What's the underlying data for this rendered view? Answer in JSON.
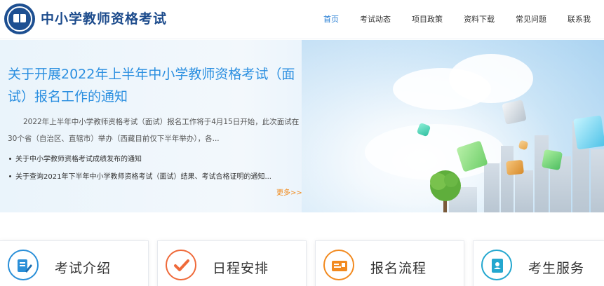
{
  "header": {
    "site_title": "中小学教师资格考试",
    "nav": [
      {
        "label": "首页",
        "active": true
      },
      {
        "label": "考试动态",
        "active": false
      },
      {
        "label": "项目政策",
        "active": false
      },
      {
        "label": "资料下载",
        "active": false
      },
      {
        "label": "常见问题",
        "active": false
      },
      {
        "label": "联系我",
        "active": false
      }
    ]
  },
  "banner": {
    "headline": "关于开展2022年上半年中小学教师资格考试（面试）报名工作的通知",
    "summary": "2022年上半年中小学教师资格考试（面试）报名工作将于4月15日开始，此次面试在30个省（自治区、直辖市）举办（西藏目前仅下半年举办），各...",
    "news": [
      "关于中小学教师资格考试成绩发布的通知",
      "关于查询2021年下半年中小学教师资格考试（面试）结果、考试合格证明的通知..."
    ],
    "more": "更多>>"
  },
  "services": [
    {
      "label": "考试介绍",
      "icon": "document-edit-icon",
      "color": "#2a8fd8"
    },
    {
      "label": "日程安排",
      "icon": "checkmark-icon",
      "color": "#ef6a3a"
    },
    {
      "label": "报名流程",
      "icon": "id-card-icon",
      "color": "#f28a1f"
    },
    {
      "label": "考生服务",
      "icon": "contact-book-icon",
      "color": "#23a7cf"
    }
  ]
}
